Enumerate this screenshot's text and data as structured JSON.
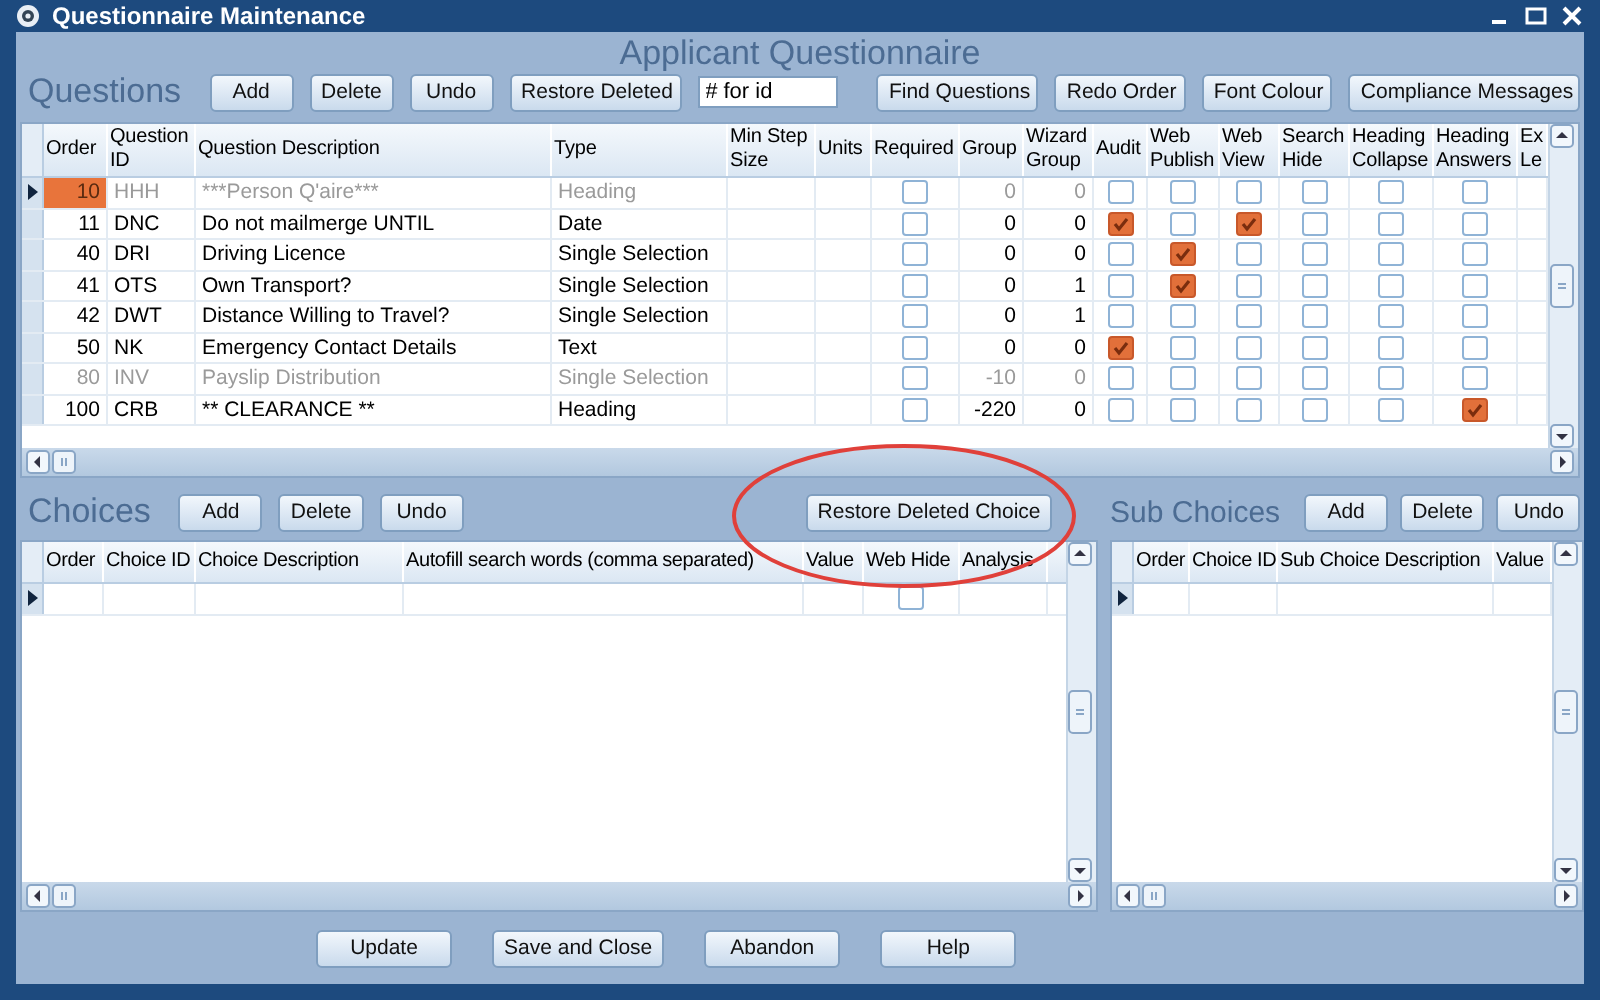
{
  "window": {
    "title": "Questionnaire Maintenance"
  },
  "heading": "Applicant Questionnaire",
  "questions": {
    "label": "Questions",
    "toolbar": [
      {
        "kind": "button",
        "label": "Add"
      },
      {
        "kind": "button",
        "label": "Delete"
      },
      {
        "kind": "button",
        "label": "Undo"
      },
      {
        "kind": "button",
        "label": "Restore Deleted"
      },
      {
        "kind": "field",
        "value": "# for id"
      },
      {
        "kind": "button",
        "label": "Find Questions"
      },
      {
        "kind": "button",
        "label": "Redo Order"
      },
      {
        "kind": "button",
        "label": "Font Colour"
      },
      {
        "kind": "button",
        "label": "Compliance Messages"
      }
    ],
    "columns": [
      {
        "label": "Order",
        "kind": "number"
      },
      {
        "label": "Question ID",
        "kind": "text"
      },
      {
        "label": "Question Description",
        "kind": "text"
      },
      {
        "label": "Type",
        "kind": "text"
      },
      {
        "label": "Min Step Size",
        "kind": "text"
      },
      {
        "label": "Units",
        "kind": "text"
      },
      {
        "label": "Required",
        "kind": "check"
      },
      {
        "label": "Group",
        "kind": "number"
      },
      {
        "label": "Wizard Group",
        "kind": "number"
      },
      {
        "label": "Audit",
        "kind": "check"
      },
      {
        "label": "Web Publish",
        "kind": "check"
      },
      {
        "label": "Web View",
        "kind": "check"
      },
      {
        "label": "Search Hide",
        "kind": "check"
      },
      {
        "label": "Heading Collapse",
        "kind": "check"
      },
      {
        "label": "Heading Answers",
        "kind": "check"
      },
      {
        "label": "Ex Le",
        "kind": "text"
      }
    ],
    "rows": [
      {
        "selected": true,
        "focused": true,
        "inactive": true,
        "cells": [
          "10",
          "HHH",
          "***Person Q'aire***",
          "Heading",
          null,
          null,
          false,
          "0",
          "0",
          false,
          false,
          false,
          false,
          false,
          false,
          null
        ]
      },
      {
        "selected": false,
        "inactive": false,
        "cells": [
          "11",
          "DNC",
          "Do not mailmerge UNTIL",
          "Date",
          null,
          null,
          false,
          "0",
          "0",
          true,
          false,
          true,
          false,
          false,
          false,
          null
        ]
      },
      {
        "selected": false,
        "inactive": false,
        "cells": [
          "40",
          "DRI",
          "Driving Licence",
          "Single Selection",
          null,
          null,
          false,
          "0",
          "0",
          false,
          true,
          false,
          false,
          false,
          false,
          null
        ]
      },
      {
        "selected": false,
        "inactive": false,
        "cells": [
          "41",
          "OTS",
          "Own Transport?",
          "Single Selection",
          null,
          null,
          false,
          "0",
          "1",
          false,
          true,
          false,
          false,
          false,
          false,
          null
        ]
      },
      {
        "selected": false,
        "inactive": false,
        "cells": [
          "42",
          "DWT",
          "Distance Willing to Travel?",
          "Single Selection",
          null,
          null,
          false,
          "0",
          "1",
          false,
          false,
          false,
          false,
          false,
          false,
          null
        ]
      },
      {
        "selected": false,
        "inactive": false,
        "cells": [
          "50",
          "NK",
          "Emergency Contact Details",
          "Text",
          null,
          null,
          false,
          "0",
          "0",
          true,
          false,
          false,
          false,
          false,
          false,
          null
        ]
      },
      {
        "selected": false,
        "inactive": true,
        "cells": [
          "80",
          "INV",
          "Payslip Distribution",
          "Single Selection",
          null,
          null,
          false,
          "-10",
          "0",
          false,
          false,
          false,
          false,
          false,
          false,
          null
        ]
      },
      {
        "selected": false,
        "inactive": false,
        "cells": [
          "100",
          "CRB",
          "** CLEARANCE **",
          "Heading",
          null,
          null,
          false,
          "-220",
          "0",
          false,
          false,
          false,
          false,
          false,
          true,
          null
        ]
      }
    ]
  },
  "choices": {
    "label": "Choices",
    "toolbar": [
      {
        "kind": "button",
        "label": "Add"
      },
      {
        "kind": "button",
        "label": "Delete"
      },
      {
        "kind": "button",
        "label": "Undo"
      },
      {
        "kind": "button",
        "label": "Restore Deleted Choice"
      }
    ],
    "columns": [
      {
        "label": "Order"
      },
      {
        "label": "Choice ID"
      },
      {
        "label": "Choice Description"
      },
      {
        "label": "Autofill search words (comma separated)"
      },
      {
        "label": "Value"
      },
      {
        "label": "Web Hide",
        "kind": "check"
      },
      {
        "label": "Analysis"
      }
    ],
    "rows": [
      {
        "selected": true,
        "cells": [
          null,
          null,
          null,
          null,
          null,
          false,
          null
        ]
      }
    ]
  },
  "sub_choices": {
    "label": "Sub Choices",
    "toolbar": [
      {
        "kind": "button",
        "label": "Add"
      },
      {
        "kind": "button",
        "label": "Delete"
      },
      {
        "kind": "button",
        "label": "Undo"
      }
    ],
    "columns": [
      {
        "label": "Order"
      },
      {
        "label": "Choice ID"
      },
      {
        "label": "Sub Choice Description"
      },
      {
        "label": "Value"
      }
    ],
    "rows": [
      {
        "selected": true,
        "cells": [
          null,
          null,
          null,
          null
        ]
      }
    ]
  },
  "buttons": [
    "Update",
    "Save and Close",
    "Abandon",
    "Help"
  ]
}
